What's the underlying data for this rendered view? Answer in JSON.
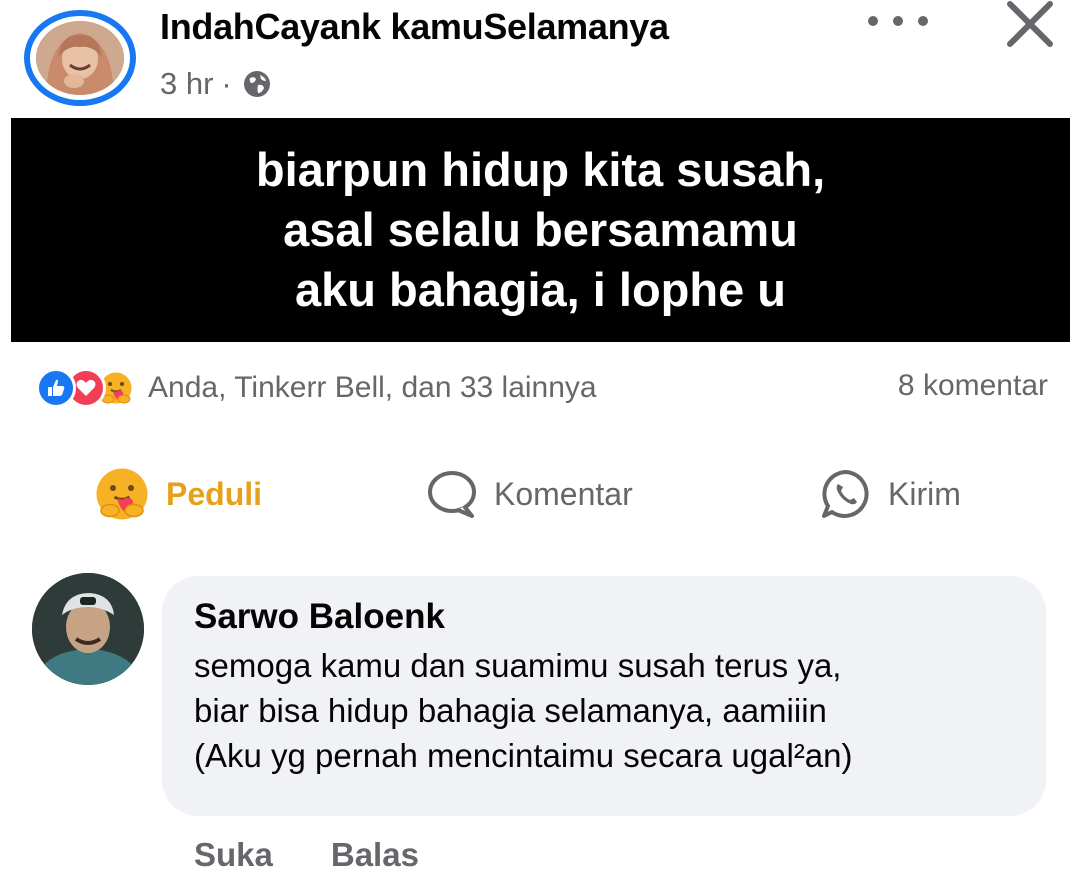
{
  "post": {
    "author": "IndahCayank kamuSelamanya",
    "time": "3 hr",
    "separator": "·",
    "privacy_icon": "globe-icon",
    "image_text": [
      "biarpun hidup kita susah,",
      "asal selalu bersamamu",
      "aku bahagia, i lophe u"
    ]
  },
  "reactions": {
    "icons": [
      "like-icon",
      "love-icon",
      "care-icon"
    ],
    "summary": "Anda, Tinkerr Bell, dan 33 lainnya",
    "comment_count": "8 komentar"
  },
  "actions": {
    "care_label": "Peduli",
    "comment_label": "Komentar",
    "send_label": "Kirim"
  },
  "comment": {
    "author": "Sarwo Baloenk",
    "lines": [
      "semoga kamu dan suamimu susah terus ya,",
      "biar bisa hidup bahagia selamanya, aamiiin",
      "(Aku yg pernah mencintaimu secara ugal²an)"
    ],
    "like_label": "Suka",
    "reply_label": "Balas"
  },
  "colors": {
    "accent": "#1877f2",
    "love": "#f33e58",
    "care": "#e5a11a",
    "muted": "#65676b",
    "bubble": "#f0f2f5"
  }
}
